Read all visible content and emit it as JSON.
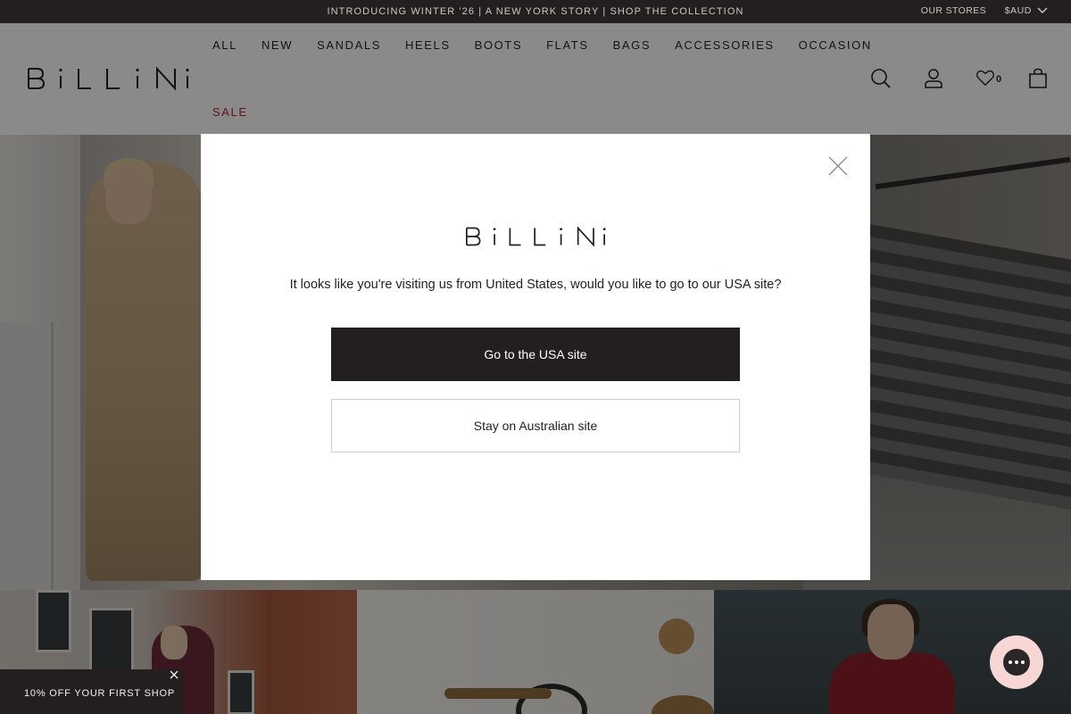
{
  "announcement": {
    "message": "INTRODUCING WINTER '26 | A NEW YORK STORY | SHOP THE COLLECTION",
    "stores_label": "OUR STORES",
    "currency_label": "$AUD"
  },
  "header": {
    "brand": "BiLLiNi",
    "nav": [
      "ALL",
      "NEW",
      "SANDALS",
      "HEELS",
      "BOOTS",
      "FLATS",
      "BAGS",
      "ACCESSORIES",
      "OCCASION"
    ],
    "sale_label": "SALE",
    "wishlist_count": "0",
    "icons": [
      "search-icon",
      "account-icon",
      "heart-icon",
      "bag-icon"
    ]
  },
  "modal": {
    "brand": "BiLLiNi",
    "prompt": "It looks like you're visiting us from United States, would you like to go to our USA site?",
    "primary_button": "Go to the USA site",
    "secondary_button": "Stay on Australian site"
  },
  "promo": {
    "label": "10% OFF YOUR FIRST SHOP"
  },
  "colors": {
    "brand_dark": "#231f20",
    "sale_red": "#b4222b",
    "chat_pink": "#f7d7d3"
  }
}
